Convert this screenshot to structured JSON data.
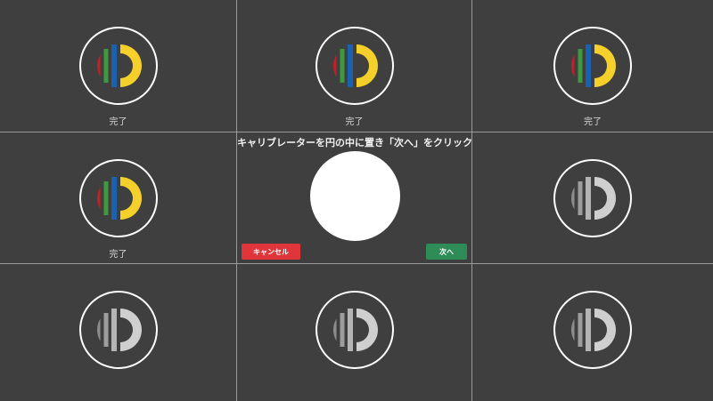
{
  "cells": [
    {
      "state": "done",
      "status": "完了"
    },
    {
      "state": "done",
      "status": "完了"
    },
    {
      "state": "done",
      "status": "完了"
    },
    {
      "state": "done",
      "status": "完了"
    },
    {
      "state": "active"
    },
    {
      "state": "pending"
    },
    {
      "state": "pending"
    },
    {
      "state": "pending"
    },
    {
      "state": "pending"
    }
  ],
  "dialog": {
    "instruction": "キャリブレーターを円の中に置き「次へ」をクリック。",
    "cancel_label": "キャンセル",
    "next_label": "次へ"
  },
  "colors": {
    "background": "#3f3f3f",
    "divider": "#9a9a9a",
    "logo_red": "#c0202a",
    "logo_green": "#3f9a3f",
    "logo_blue": "#1a62b0",
    "logo_yellow": "#f5cf2a",
    "pending_light": "#cfcfcf",
    "pending_dark": "#8d8d8d",
    "cancel": "#e0353b",
    "next": "#2e8c57"
  },
  "icons": {
    "logo": "calibrator-logo-icon",
    "target": "target-circle"
  }
}
